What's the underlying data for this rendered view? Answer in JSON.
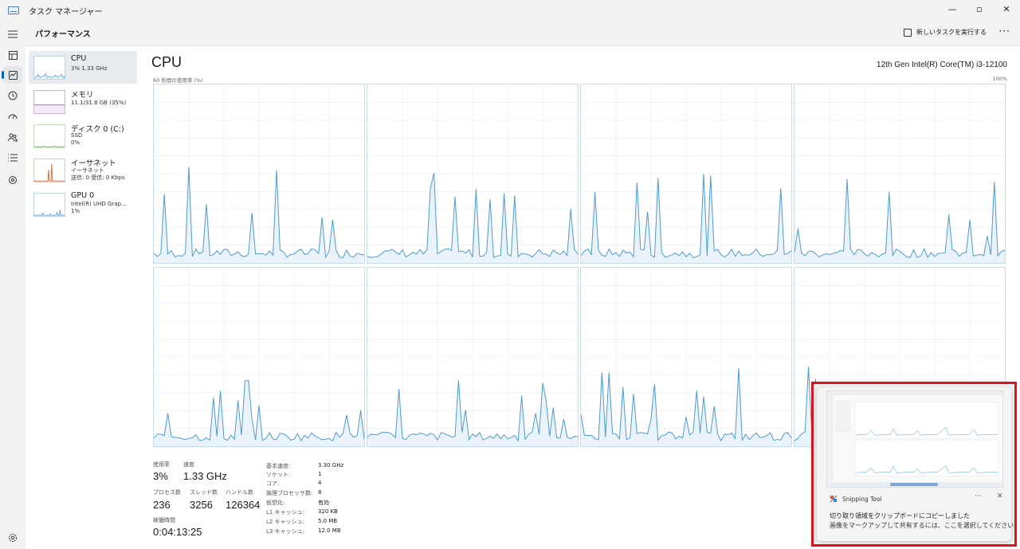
{
  "window": {
    "title": "タスク マネージャー",
    "min": "—",
    "max": "▫",
    "close": "✕"
  },
  "header": {
    "title": "パフォーマンス",
    "run_task": "新しいタスクを実行する",
    "more": "···"
  },
  "resources": [
    {
      "name": "CPU",
      "sub1": "3%  1.33 GHz",
      "sub2": "",
      "sub3": ""
    },
    {
      "name": "メモリ",
      "sub1": "11.1/31.8 GB (35%)",
      "sub2": "",
      "sub3": ""
    },
    {
      "name": "ディスク 0 (C:)",
      "sub1": "SSD",
      "sub2": "0%",
      "sub3": ""
    },
    {
      "name": "イーサネット",
      "sub1": "イーサネット",
      "sub2": "送信: 0 受信: 0 Kbps",
      "sub3": ""
    },
    {
      "name": "GPU 0",
      "sub1": "Intel(R) UHD Grap...",
      "sub2": "1%",
      "sub3": ""
    }
  ],
  "main": {
    "title": "CPU",
    "model": "12th Gen Intel(R) Core(TM) i3-12100",
    "chart_left": "60 秒間の使用率 (%)",
    "chart_right": "100%"
  },
  "stats": {
    "usage_label": "使用率",
    "usage": "3%",
    "speed_label": "速度",
    "speed": "1.33 GHz",
    "proc_label": "プロセス数",
    "proc": "236",
    "thread_label": "スレッド数",
    "thread": "3256",
    "handle_label": "ハンドル数",
    "handle": "126364",
    "uptime_label": "稼働時間",
    "uptime": "0:04:13:25"
  },
  "specs": [
    {
      "label": "基本速度:",
      "value": "3.30 GHz"
    },
    {
      "label": "ソケット:",
      "value": "1"
    },
    {
      "label": "コア:",
      "value": "4"
    },
    {
      "label": "論理プロセッサ数:",
      "value": "8"
    },
    {
      "label": "仮想化:",
      "value": "有効"
    },
    {
      "label": "L1 キャッシュ:",
      "value": "320 KB"
    },
    {
      "label": "L2 キャッシュ:",
      "value": "5.0 MB"
    },
    {
      "label": "L3 キャッシュ:",
      "value": "12.0 MB"
    }
  ],
  "toast": {
    "app": "Snipping Tool",
    "more": "···",
    "close": "✕",
    "message": "切り取り領域をクリップボードにコピーしました",
    "sub": "画像をマークアップして共有するには、ここを選択してください"
  },
  "colors": {
    "accent": "#0067c0",
    "graph_line": "#4b9bd1",
    "graph_fill": "#eaf3fa",
    "grid": "#d6e6f3",
    "toast_border": "#e0121a"
  }
}
